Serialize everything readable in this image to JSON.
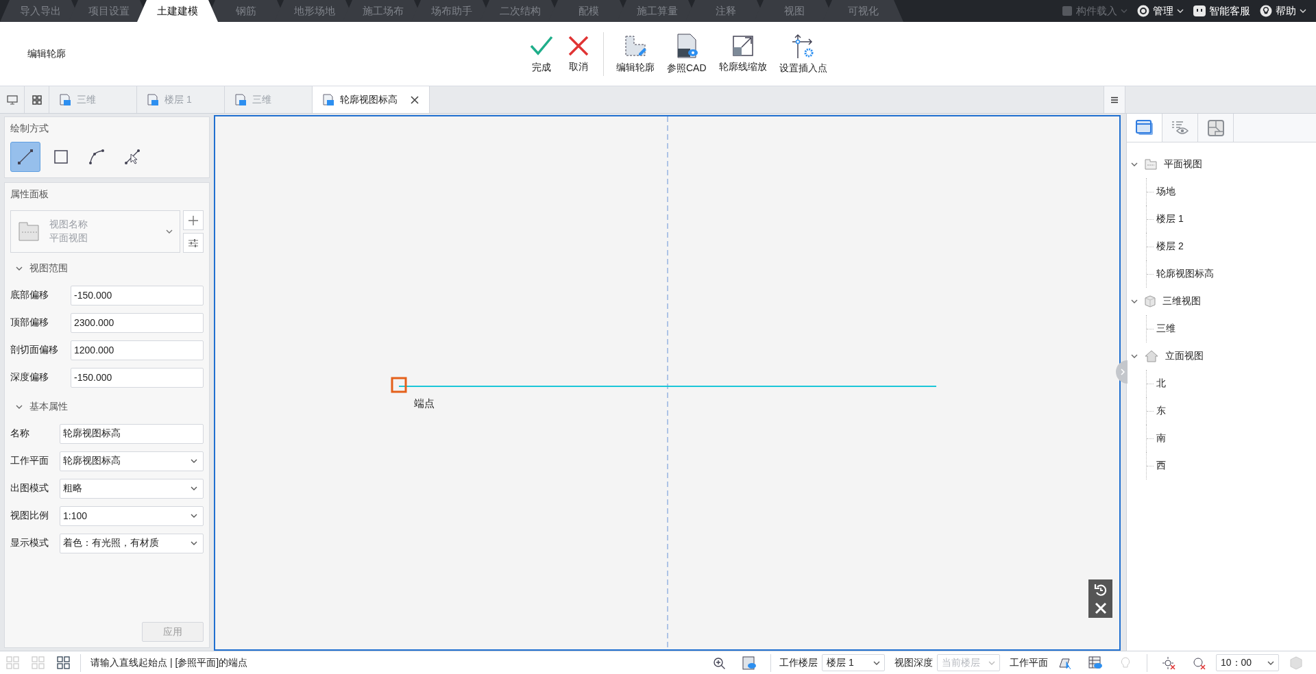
{
  "menu_tabs": [
    {
      "label": "导入导出",
      "selected": false
    },
    {
      "label": "项目设置",
      "selected": false
    },
    {
      "label": "土建建模",
      "selected": true
    },
    {
      "label": "钢筋",
      "selected": false
    },
    {
      "label": "地形场地",
      "selected": false
    },
    {
      "label": "施工场布",
      "selected": false
    },
    {
      "label": "场布助手",
      "selected": false
    },
    {
      "label": "二次结构",
      "selected": false
    },
    {
      "label": "配模",
      "selected": false
    },
    {
      "label": "施工算量",
      "selected": false
    },
    {
      "label": "注释",
      "selected": false
    },
    {
      "label": "视图",
      "selected": false
    },
    {
      "label": "可视化",
      "selected": false
    }
  ],
  "top_actions": [
    {
      "label": "构件载入",
      "disabled": true,
      "has_menu": true
    },
    {
      "label": "管理",
      "disabled": false,
      "has_menu": true
    },
    {
      "label": "智能客服",
      "disabled": false,
      "has_menu": false
    },
    {
      "label": "帮助",
      "disabled": false,
      "has_menu": true
    }
  ],
  "ribbon": {
    "title": "编辑轮廓",
    "groups": [
      [
        {
          "label": "完成"
        },
        {
          "label": "取消"
        }
      ],
      [
        {
          "label": "编辑轮廓"
        },
        {
          "label": "参照CAD"
        },
        {
          "label": "轮廓线缩放"
        },
        {
          "label": "设置插入点"
        }
      ]
    ]
  },
  "doc_tabs": [
    {
      "label": "三维",
      "selected": false
    },
    {
      "label": "楼层 1",
      "selected": false
    },
    {
      "label": "三维",
      "selected": false
    },
    {
      "label": "轮廓视图标高",
      "selected": true
    }
  ],
  "draw_panel": {
    "title": "绘制方式",
    "tools": [
      {
        "selected": true
      },
      {
        "selected": false
      },
      {
        "selected": false
      },
      {
        "selected": false
      }
    ]
  },
  "property_panel": {
    "title": "属性面板",
    "type_selector": {
      "lines": [
        "视图名称",
        "平面视图"
      ]
    },
    "sections": [
      {
        "title": "视图范围",
        "expanded": true,
        "fields": [
          {
            "label": "底部偏移",
            "value": "-150.000",
            "kind": "text"
          },
          {
            "label": "顶部偏移",
            "value": "2300.000",
            "kind": "text"
          },
          {
            "label": "剖切面偏移",
            "value": "1200.000",
            "kind": "text"
          },
          {
            "label": "深度偏移",
            "value": "-150.000",
            "kind": "text"
          }
        ]
      },
      {
        "title": "基本属性",
        "expanded": true,
        "fields": [
          {
            "label": "名称",
            "value": "轮廓视图标高",
            "kind": "text"
          },
          {
            "label": "工作平面",
            "value": "轮廓视图标高",
            "kind": "select"
          },
          {
            "label": "出图模式",
            "value": "粗略",
            "kind": "select"
          },
          {
            "label": "视图比例",
            "value": "1:100",
            "kind": "select"
          },
          {
            "label": "显示模式",
            "value": "着色：有光照，有材质",
            "kind": "select"
          }
        ]
      }
    ],
    "apply_button": {
      "label": "应用",
      "disabled": true
    }
  },
  "canvas": {
    "point_label": "端点"
  },
  "right_panel": {
    "tabs": [
      {
        "selected": true
      },
      {
        "selected": false
      },
      {
        "selected": false
      }
    ],
    "tree": [
      {
        "label": "平面视图",
        "expanded": true,
        "children": [
          {
            "label": "场地"
          },
          {
            "label": "楼层 1"
          },
          {
            "label": "楼层 2"
          },
          {
            "label": "轮廓视图标高"
          }
        ]
      },
      {
        "label": "三维视图",
        "expanded": true,
        "children": [
          {
            "label": "三维"
          }
        ]
      },
      {
        "label": "立面视图",
        "expanded": true,
        "children": [
          {
            "label": "北"
          },
          {
            "label": "东"
          },
          {
            "label": "南"
          },
          {
            "label": "西"
          }
        ]
      }
    ]
  },
  "status_bar": {
    "message": "请输入直线起始点 | [参照平面]的端点",
    "work_floor": {
      "label": "工作楼层",
      "value": "楼层 1",
      "disabled": false
    },
    "view_depth": {
      "label": "视图深度",
      "value": "当前楼层",
      "disabled": true
    },
    "work_plane": {
      "label": "工作平面"
    },
    "time": {
      "value": "10：00",
      "disabled": false
    }
  }
}
